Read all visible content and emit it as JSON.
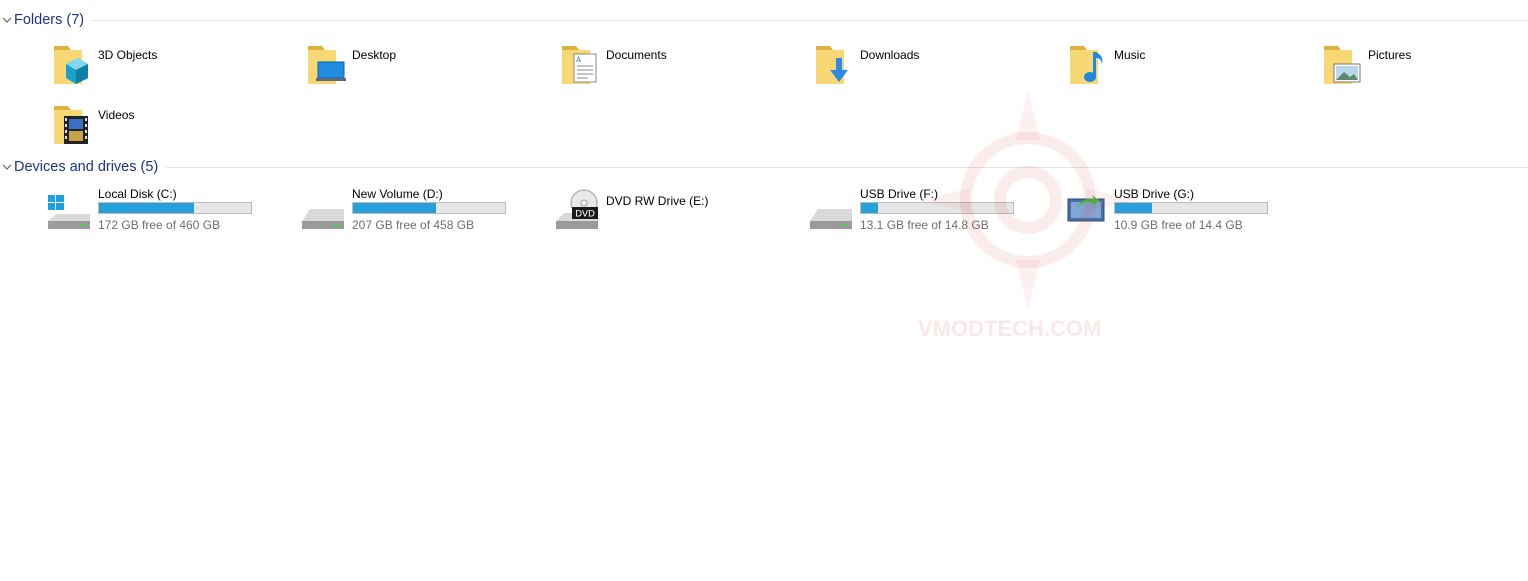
{
  "groups": {
    "folders": {
      "title": "Folders (7)"
    },
    "devices": {
      "title": "Devices and drives (5)"
    }
  },
  "folders": [
    {
      "label": "3D Objects",
      "icon": "3d-objects-folder-icon"
    },
    {
      "label": "Desktop",
      "icon": "desktop-folder-icon"
    },
    {
      "label": "Documents",
      "icon": "documents-folder-icon"
    },
    {
      "label": "Downloads",
      "icon": "downloads-folder-icon"
    },
    {
      "label": "Music",
      "icon": "music-folder-icon"
    },
    {
      "label": "Pictures",
      "icon": "pictures-folder-icon"
    },
    {
      "label": "Videos",
      "icon": "videos-folder-icon"
    }
  ],
  "drives": [
    {
      "name": "Local Disk (C:)",
      "free_text": "172 GB free of 460 GB",
      "used_fraction": 0.626,
      "icon": "windows-drive-icon",
      "show_bar": true
    },
    {
      "name": "New Volume (D:)",
      "free_text": "207 GB free of 458 GB",
      "used_fraction": 0.548,
      "icon": "hard-drive-icon",
      "show_bar": true
    },
    {
      "name": "DVD RW Drive (E:)",
      "free_text": "",
      "used_fraction": 0,
      "icon": "dvd-drive-icon",
      "show_bar": false,
      "badge": "DVD"
    },
    {
      "name": "USB Drive (F:)",
      "free_text": "13.1 GB free of 14.8 GB",
      "used_fraction": 0.115,
      "icon": "usb-drive-icon",
      "show_bar": true
    },
    {
      "name": "USB Drive (G:)",
      "free_text": "10.9 GB free of 14.4 GB",
      "used_fraction": 0.243,
      "icon": "usb-autoplay-drive-icon",
      "show_bar": true
    }
  ],
  "watermark": {
    "text": "VMODTECH.COM"
  },
  "colors": {
    "group_title": "#1e3287",
    "bar_fill": "#26a0da",
    "bar_bg": "#e6e6e6",
    "folder_yellow": "#f8d775"
  }
}
